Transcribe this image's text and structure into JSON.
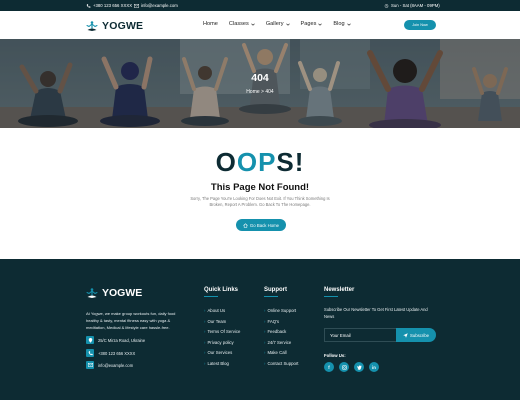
{
  "topbar": {
    "phone": "+380 123 656 XXXX",
    "email": "info@example.com",
    "hours": "Sun - Sat (8AAM - 09PM)"
  },
  "brand": {
    "name": "YOGWE"
  },
  "nav": {
    "items": [
      {
        "label": "Home"
      },
      {
        "label": "Classes"
      },
      {
        "label": "Gallery"
      },
      {
        "label": "Pages"
      },
      {
        "label": "Blog"
      }
    ],
    "cta": "Join Now"
  },
  "hero": {
    "title": "404",
    "crumb_home": "Home",
    "crumb_sep": ">",
    "crumb_current": "404"
  },
  "error": {
    "oops_o1": "O",
    "oops_o2": "O",
    "oops_p": "P",
    "oops_s": "S!",
    "title": "This Page Not Found!",
    "text": "Sorry, The Page You're Looking For Does Not Exit. If You Think Something Is Broken, Report A Problem. Go Back To The Homepage.",
    "button": "Go Back Home"
  },
  "footer": {
    "about": "At Yogwe, we make group workouts fun, daily food healthy & tasty, mental fitness easy with yoga & meditation, Medical & lifestyle care hassle-free.",
    "address": "25/C Mirza Road, Ukraine",
    "phone": "+380 123 656 XXXX",
    "email": "info@example.com",
    "quick_links": {
      "heading": "Quick Links",
      "items": [
        "About Us",
        "Our Team",
        "Terms Of Service",
        "Privacy policy",
        "Our Services",
        "Latest Blog"
      ]
    },
    "support": {
      "heading": "Support",
      "items": [
        "Online Support",
        "FAQ's",
        "Feedback",
        "24/7 Service",
        "Make Call",
        "Contact Support"
      ]
    },
    "newsletter": {
      "heading": "Newsletter",
      "text": "Subscribe Our Newsletter To Get First Latest Update And News",
      "placeholder": "Your Email",
      "button": "Subscribe",
      "follow": "Follow Us:",
      "socials": [
        "f",
        "in",
        "t",
        "in"
      ]
    }
  },
  "colors": {
    "accent": "#1591ad",
    "dark": "#0d2b33"
  }
}
